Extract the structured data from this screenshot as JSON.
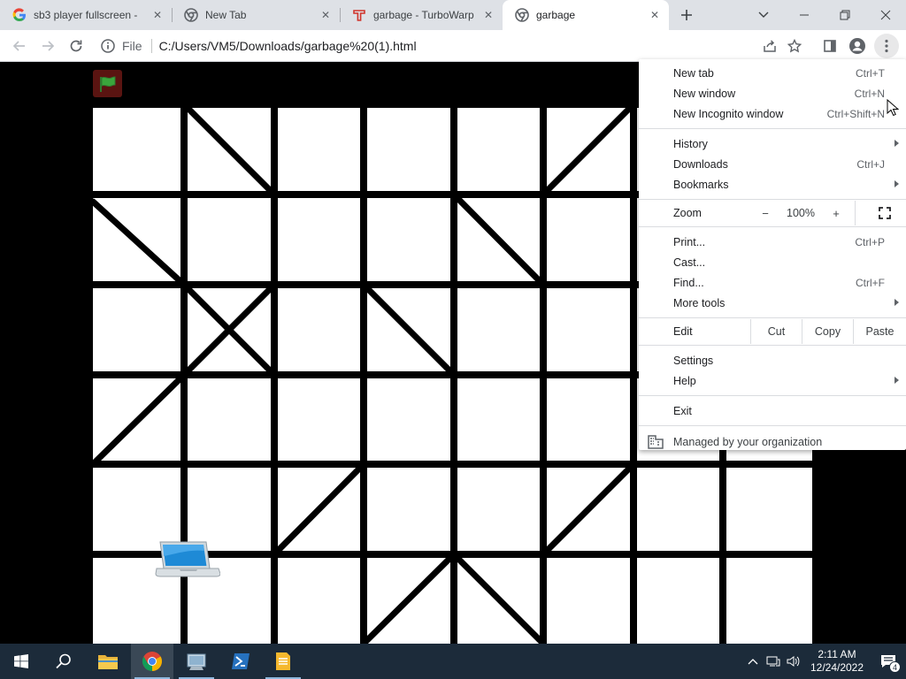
{
  "tabs": [
    {
      "title": "sb3 player fullscreen - ",
      "favicon": "google-g-icon",
      "active": false
    },
    {
      "title": "New Tab",
      "favicon": "chrome-icon",
      "active": false
    },
    {
      "title": "garbage - TurboWarp",
      "favicon": "turbowarp-icon",
      "active": false
    },
    {
      "title": "garbage",
      "favicon": "chrome-icon",
      "active": true
    }
  ],
  "toolbar": {
    "chip_label": "File",
    "url": "C:/Users/VM5/Downloads/garbage%20(1).html"
  },
  "menu": {
    "items_top": [
      {
        "label": "New tab",
        "shortcut": "Ctrl+T"
      },
      {
        "label": "New window",
        "shortcut": "Ctrl+N"
      },
      {
        "label": "New Incognito window",
        "shortcut": "Ctrl+Shift+N"
      }
    ],
    "items_history": [
      {
        "label": "History",
        "shortcut": "",
        "submenu": true
      },
      {
        "label": "Downloads",
        "shortcut": "Ctrl+J",
        "submenu": false
      },
      {
        "label": "Bookmarks",
        "shortcut": "",
        "submenu": true
      }
    ],
    "zoom": {
      "label": "Zoom",
      "minus": "−",
      "value": "100%",
      "plus": "+"
    },
    "items_tools": [
      {
        "label": "Print...",
        "shortcut": "Ctrl+P",
        "submenu": false
      },
      {
        "label": "Cast...",
        "shortcut": "",
        "submenu": false
      },
      {
        "label": "Find...",
        "shortcut": "Ctrl+F",
        "submenu": false
      },
      {
        "label": "More tools",
        "shortcut": "",
        "submenu": true
      }
    ],
    "edit": {
      "label": "Edit",
      "cut": "Cut",
      "copy": "Copy",
      "paste": "Paste"
    },
    "items_settings": [
      {
        "label": "Settings",
        "submenu": false
      },
      {
        "label": "Help",
        "submenu": true
      }
    ],
    "exit": "Exit",
    "managed": "Managed by your organization"
  },
  "taskbar": {
    "time": "2:11 AM",
    "date": "12/24/2022",
    "notifications": "4"
  },
  "colors": {
    "tabstrip": "#dee1e6",
    "taskbar": "#1c2b3a",
    "flag_bg": "#5a1411",
    "flag": "#3aa63c"
  }
}
